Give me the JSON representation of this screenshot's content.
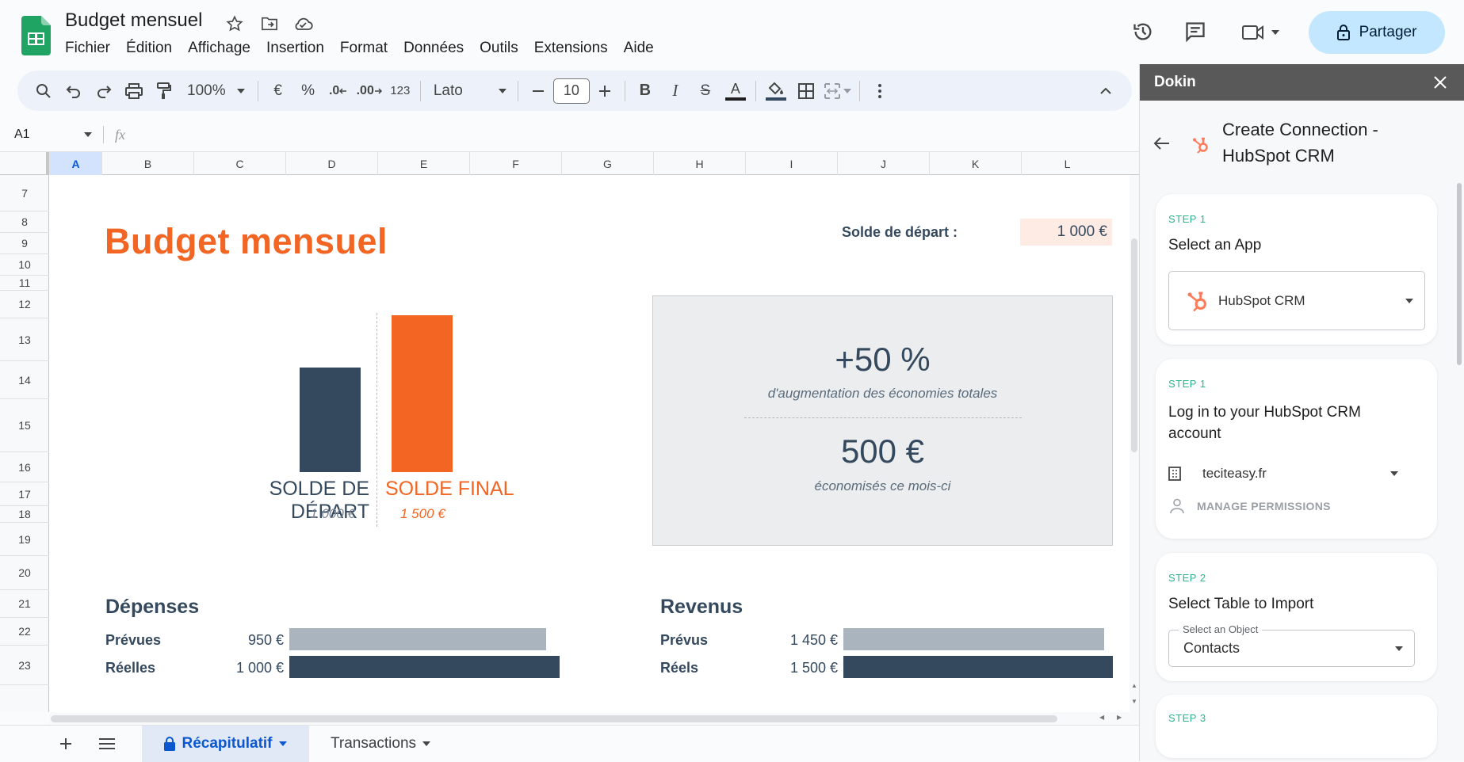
{
  "header": {
    "title": "Budget mensuel",
    "menus": [
      "Fichier",
      "Édition",
      "Affichage",
      "Insertion",
      "Format",
      "Données",
      "Outils",
      "Extensions",
      "Aide"
    ],
    "share_label": "Partager"
  },
  "toolbar": {
    "zoom": "100%",
    "currency": "€",
    "percent": "%",
    "dec_minus": ".0",
    "dec_plus": ".00",
    "num_format": "123",
    "font": "Lato",
    "font_size": "10"
  },
  "formula": {
    "cell_ref": "A1",
    "fx": "fx"
  },
  "columns": [
    "A",
    "B",
    "C",
    "D",
    "E",
    "F",
    "G",
    "H",
    "I",
    "J",
    "K",
    "L"
  ],
  "rows": [
    "7",
    "8",
    "9",
    "10",
    "11",
    "12",
    "13",
    "14",
    "15",
    "16",
    "17",
    "18",
    "19",
    "20",
    "21",
    "22",
    "23"
  ],
  "sheet": {
    "title": "Budget mensuel",
    "solde_depart_label": "Solde de départ :",
    "solde_depart_value": "1 000 €",
    "chart": {
      "label_start": "SOLDE DE DÉPART",
      "label_end": "SOLDE FINAL",
      "value_start": "1 000 €",
      "value_end": "1 500 €"
    },
    "summary": {
      "pct": "+50 %",
      "pct_caption": "d'augmentation des économies totales",
      "amount": "500 €",
      "amount_caption": "économisés ce mois-ci"
    },
    "expenses": {
      "title": "Dépenses",
      "planned_label": "Prévues",
      "planned_value": "950 €",
      "actual_label": "Réelles",
      "actual_value": "1 000 €"
    },
    "income": {
      "title": "Revenus",
      "planned_label": "Prévus",
      "planned_value": "1 450 €",
      "actual_label": "Réels",
      "actual_value": "1 500 €"
    }
  },
  "tabs": {
    "recap": "Récapitulatif",
    "transactions": "Transactions"
  },
  "panel": {
    "name": "Dokin",
    "title": "Create Connection - HubSpot CRM",
    "step1_label": "STEP 1",
    "step1_title": "Select an App",
    "step1_value": "HubSpot CRM",
    "step1b_label": "STEP 1",
    "step1b_title": "Log in to your HubSpot CRM account",
    "account": "teciteasy.fr",
    "manage": "MANAGE PERMISSIONS",
    "step2_label": "STEP 2",
    "step2_title": "Select Table to Import",
    "object_label": "Select an Object",
    "object_value": "Contacts",
    "step3_label": "STEP 3"
  },
  "colors": {
    "accent": "#f26522",
    "navy": "#34495e",
    "share_bg": "#c2e7ff",
    "step_green": "#2bb58f"
  }
}
